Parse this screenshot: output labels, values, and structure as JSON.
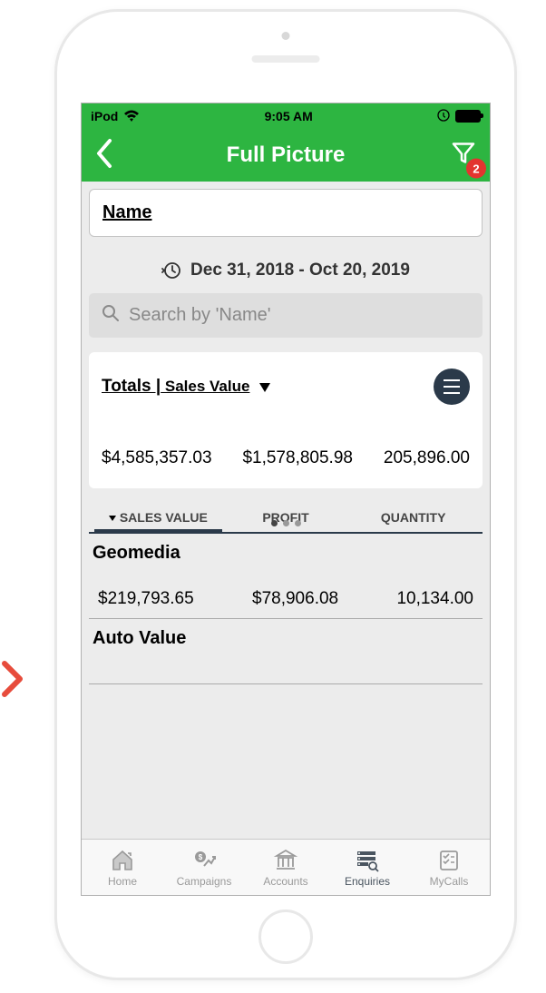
{
  "status_bar": {
    "device": "iPod",
    "time": "9:05 AM"
  },
  "header": {
    "title": "Full Picture",
    "filter_badge": "2"
  },
  "name_field": "Name",
  "date_range": "Dec 31, 2018 - Oct 20, 2019",
  "search": {
    "placeholder": "Search by 'Name'"
  },
  "totals": {
    "label": "Totals |",
    "sort_label": " Sales Value",
    "sales_value": "$4,585,357.03",
    "profit": "$1,578,805.98",
    "quantity": "205,896.00"
  },
  "tabs": {
    "tab1": "SALES VALUE",
    "tab2": "PROFIT",
    "tab3": "QUANTITY"
  },
  "items": [
    {
      "name": "Geomedia",
      "sales_value": "$219,793.65",
      "profit": "$78,906.08",
      "quantity": "10,134.00"
    },
    {
      "name": "Auto Value",
      "sales_value": "",
      "profit": "",
      "quantity": ""
    }
  ],
  "bottom_nav": {
    "home": "Home",
    "campaigns": "Campaigns",
    "accounts": "Accounts",
    "enquiries": "Enquiries",
    "mycalls": "MyCalls"
  }
}
